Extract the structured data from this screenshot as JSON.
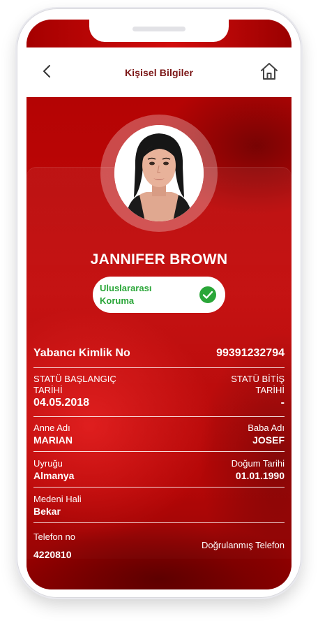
{
  "header": {
    "title": "Kişisel Bilgiler"
  },
  "profile": {
    "name": "JANNIFER BROWN",
    "badge_line1": "Uluslararası",
    "badge_line2": "Koruma"
  },
  "id": {
    "label": "Yabancı Kimlik No",
    "value": "99391232794"
  },
  "status": {
    "start_label_1": "STATÜ BAŞLANGIÇ",
    "start_label_2": "TARİHİ",
    "start_value": "04.05.2018",
    "end_label_1": "STATÜ BİTİŞ",
    "end_label_2": "TARİHİ",
    "end_value": "-"
  },
  "parents": {
    "mother_label": "Anne Adı",
    "mother_value": "MARIAN",
    "father_label": "Baba Adı",
    "father_value": "JOSEF"
  },
  "origin": {
    "nationality_label": "Uyruğu",
    "nationality_value": "Almanya",
    "birth_label": "Doğum Tarihi",
    "birth_value": "01.01.1990"
  },
  "marital": {
    "label": "Medeni Hali",
    "value": "Bekar"
  },
  "phone": {
    "label": "Telefon no",
    "value": "4220810",
    "verified_text": "Doğrulanmış Telefon"
  },
  "colors": {
    "brand_red": "#c30808",
    "title_red": "#7a1414",
    "badge_green": "#2aa638"
  },
  "icons": [
    "chevron-left-icon",
    "home-icon",
    "check-circle-icon"
  ]
}
